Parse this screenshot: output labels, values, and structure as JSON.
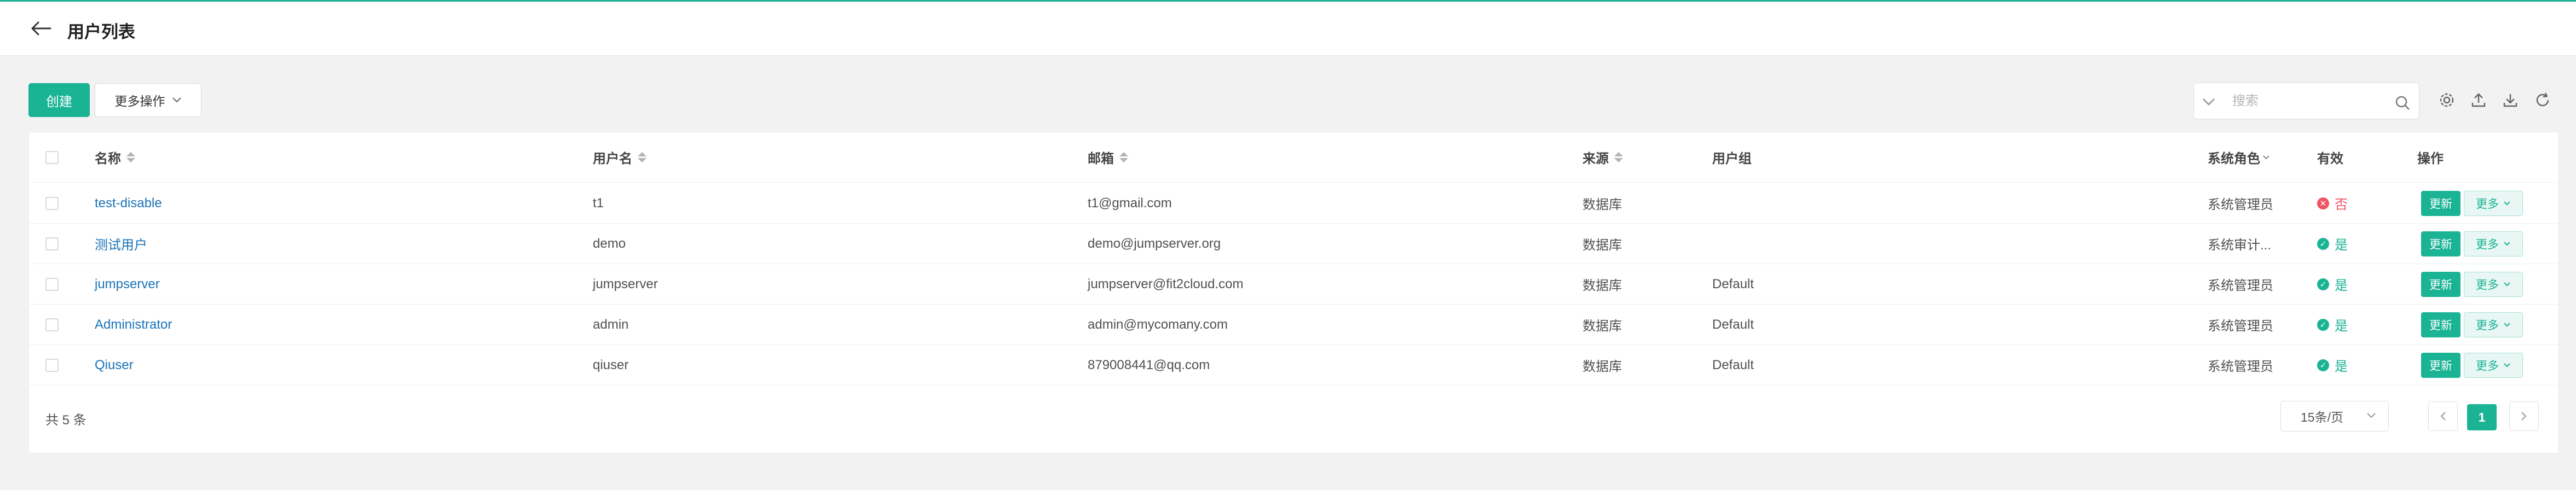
{
  "header": {
    "title": "用户列表"
  },
  "toolbar": {
    "create_label": "创建",
    "more_actions_label": "更多操作",
    "search_placeholder": "搜索"
  },
  "table": {
    "columns": {
      "name": "名称",
      "username": "用户名",
      "email": "邮箱",
      "source": "来源",
      "groups": "用户组",
      "role": "系统角色",
      "active": "有效",
      "actions": "操作"
    },
    "rows": [
      {
        "name": "test-disable",
        "username": "t1",
        "email": "t1@gmail.com",
        "source": "数据库",
        "groups": "",
        "role": "系统管理员",
        "active": "否",
        "update": "更新",
        "more": "更多"
      },
      {
        "name": "测试用户",
        "username": "demo",
        "email": "demo@jumpserver.org",
        "source": "数据库",
        "groups": "",
        "role": "系统审计...",
        "active": "是",
        "update": "更新",
        "more": "更多"
      },
      {
        "name": "jumpserver",
        "username": "jumpserver",
        "email": "jumpserver@fit2cloud.com",
        "source": "数据库",
        "groups": "Default",
        "role": "系统管理员",
        "active": "是",
        "update": "更新",
        "more": "更多"
      },
      {
        "name": "Administrator",
        "username": "admin",
        "email": "admin@mycomany.com",
        "source": "数据库",
        "groups": "Default",
        "role": "系统管理员",
        "active": "是",
        "update": "更新",
        "more": "更多"
      },
      {
        "name": "Qiuser",
        "username": "qiuser",
        "email": "879008441@qq.com",
        "source": "数据库",
        "groups": "Default",
        "role": "系统管理员",
        "active": "是",
        "update": "更新",
        "more": "更多"
      }
    ]
  },
  "pagination": {
    "total_text": "共 5 条",
    "page_size": "15条/页",
    "current_page": "1"
  },
  "colors": {
    "accent": "#1ab394",
    "link": "#1a73b8",
    "active_yes": "#1ab394",
    "active_no": "#ed5565"
  }
}
